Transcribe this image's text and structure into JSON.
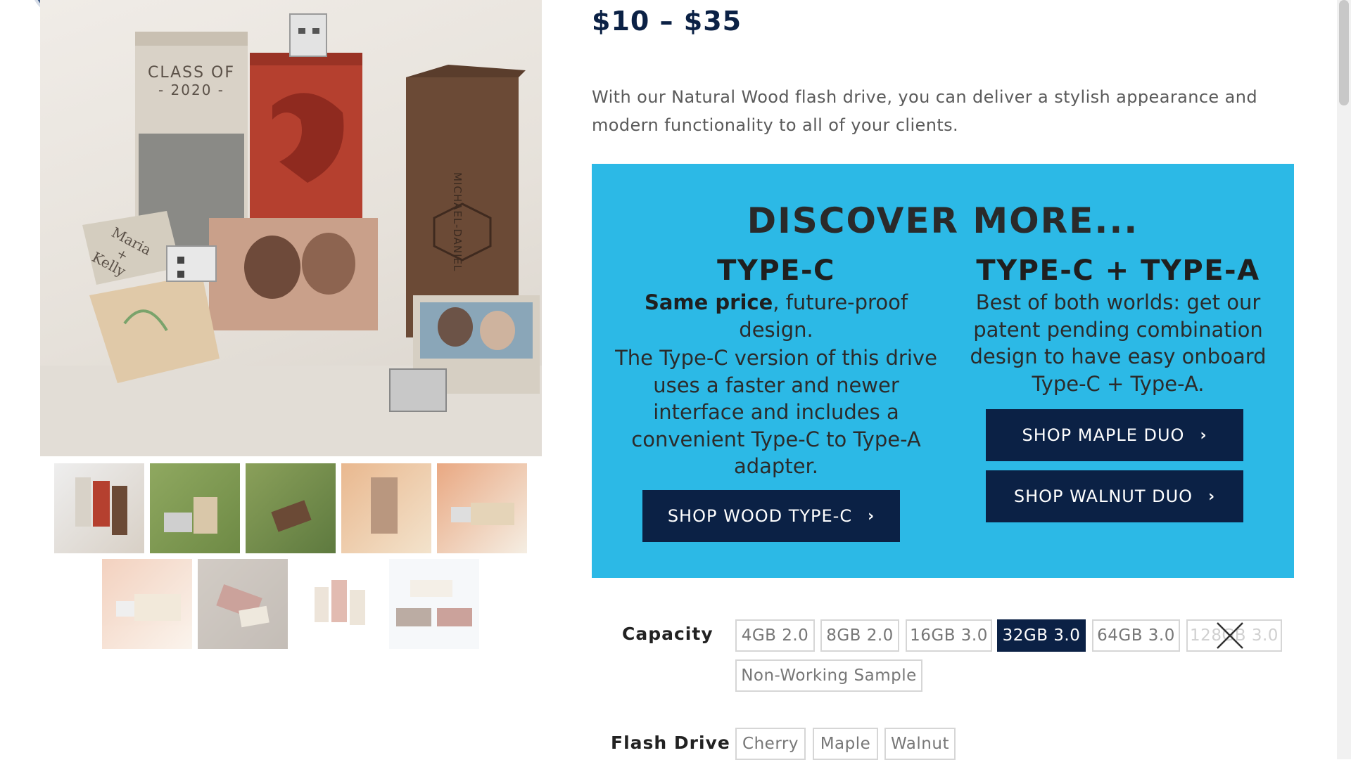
{
  "product": {
    "price": "$10 – $35",
    "description": "With our Natural Wood flash drive, you can deliver a stylish appearance and modern functionality to all of your clients."
  },
  "gallery": {
    "main_image_labels": {
      "class_of": "CLASS OF",
      "year": "- 2020 -",
      "name_left_1": "Maria",
      "name_left_2": "+",
      "name_left_3": "Kelly",
      "name_right": "MICHAEL-DANIEL"
    },
    "thumbnail_icons": [
      "product-thumb",
      "product-thumb",
      "product-thumb",
      "product-thumb",
      "product-thumb",
      "product-thumb",
      "product-thumb",
      "product-thumb",
      "product-thumb"
    ]
  },
  "promo": {
    "title": "DISCOVER MORE...",
    "left": {
      "heading": "TYPE-C",
      "bold_lead": "Same price",
      "lead_rest": ", future-proof design.",
      "body": "The Type-C version of this drive uses a faster and newer interface and includes a convenient Type-C to Type-A adapter.",
      "button": "SHOP WOOD TYPE-C"
    },
    "right": {
      "heading": "TYPE-C + TYPE-A",
      "body": "Best of both worlds: get our patent pending combination design to have easy onboard Type-C + Type-A.",
      "button1": "SHOP MAPLE DUO",
      "button2": "SHOP WALNUT DUO"
    },
    "chevron": "›"
  },
  "options": {
    "capacity_label": "Capacity",
    "capacity": [
      "4GB 2.0",
      "8GB 2.0",
      "16GB 3.0",
      "32GB 3.0",
      "64GB 3.0",
      "128GB 3.0",
      "Non-Working Sample"
    ],
    "selected_capacity": "32GB 3.0",
    "unavailable_capacity": "128GB 3.0",
    "color_label": "Flash Drive",
    "colors": [
      "Cherry",
      "Maple",
      "Walnut"
    ]
  },
  "colors": {
    "navy": "#0b2145",
    "promo_blue": "#2cb9e6"
  }
}
